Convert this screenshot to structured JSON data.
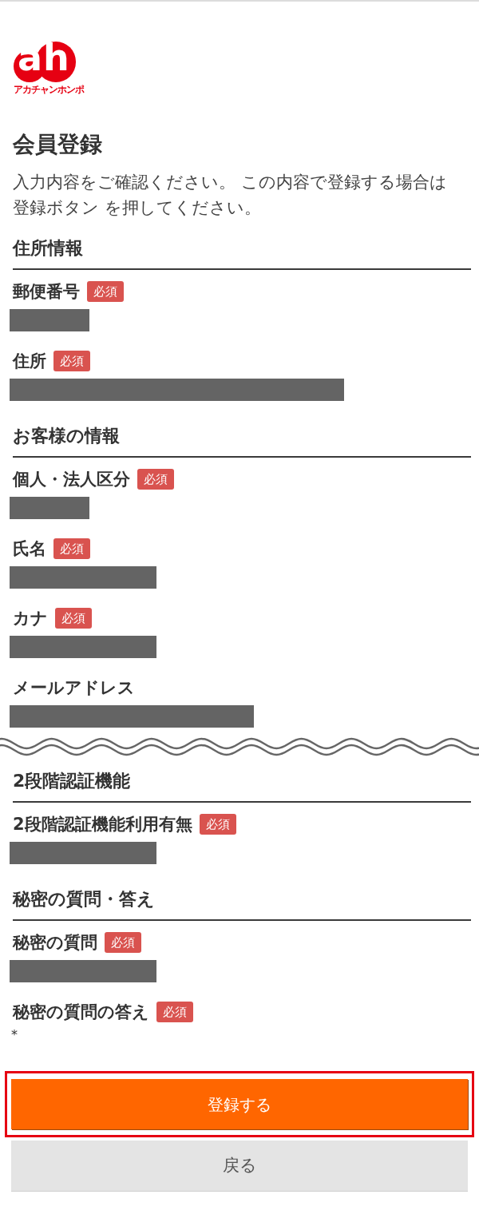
{
  "logo": {
    "mark": "ah",
    "name": "アカチャンホンポ"
  },
  "header": {
    "title": "会員登録",
    "description": "入力内容をご確認ください。 この内容で登録する場合は登録ボタン を押してください。"
  },
  "sections": [
    {
      "title": "住所情報",
      "break_before": false,
      "fields": [
        {
          "label": "郵便番号",
          "required": true,
          "badge": "必須",
          "masked": true
        },
        {
          "label": "住所",
          "required": true,
          "badge": "必須",
          "masked": true
        }
      ]
    },
    {
      "title": "お客様の情報",
      "break_before": false,
      "fields": [
        {
          "label": "個人・法人区分",
          "required": true,
          "badge": "必須",
          "masked": true
        },
        {
          "label": "氏名",
          "required": true,
          "badge": "必須",
          "masked": true
        },
        {
          "label": "カナ",
          "required": true,
          "badge": "必須",
          "masked": true
        },
        {
          "label": "メールアドレス",
          "required": false,
          "masked": true
        }
      ]
    },
    {
      "title": "2段階認証機能",
      "break_before": true,
      "fields": [
        {
          "label": "2段階認証機能利用有無",
          "required": true,
          "badge": "必須",
          "masked": true
        }
      ]
    },
    {
      "title": "秘密の質問・答え",
      "break_before": false,
      "fields": [
        {
          "label": "秘密の質問",
          "required": true,
          "badge": "必須",
          "masked": true
        },
        {
          "label": "秘密の質問の答え",
          "required": true,
          "badge": "必須",
          "masked": false,
          "value": "*"
        }
      ]
    }
  ],
  "actions": [
    {
      "label": "登録する",
      "kind": "primary",
      "highlighted": true
    },
    {
      "label": "戻る",
      "kind": "secondary",
      "highlighted": false
    }
  ]
}
